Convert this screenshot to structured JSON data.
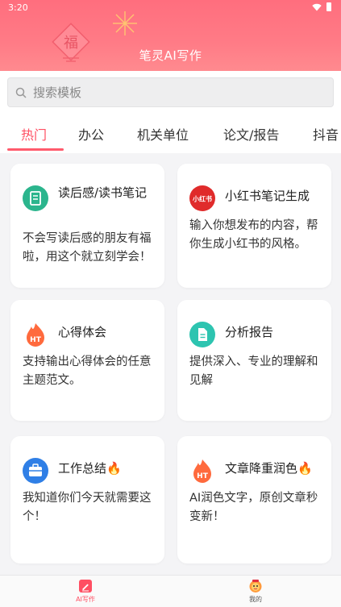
{
  "status_bar": {
    "time": "3:20"
  },
  "app": {
    "title": "笔灵AI写作"
  },
  "search": {
    "placeholder": "搜索模板"
  },
  "tabs": [
    {
      "label": "热门",
      "active": true
    },
    {
      "label": "办公",
      "active": false
    },
    {
      "label": "机关单位",
      "active": false
    },
    {
      "label": "论文/报告",
      "active": false
    },
    {
      "label": "抖音",
      "active": false
    }
  ],
  "cards": [
    {
      "title": "读后感/读书笔记",
      "desc": "不会写读后感的朋友有福啦，用这个就立刻学会！",
      "icon": "notebook-icon",
      "color": "#2bb58d"
    },
    {
      "title": "小红书笔记生成",
      "desc": "输入你想发布的内容，帮你生成小红书的风格。",
      "icon": "xiaohongshu-icon",
      "icon_text": "小红书",
      "color": "#e02b2b"
    },
    {
      "title": "心得体会",
      "desc": "支持输出心得体会的任意主题范文。",
      "icon": "ht-flame-icon",
      "icon_text": "HT",
      "color": "#ff6a3d"
    },
    {
      "title": "分析报告",
      "desc": "提供深入、专业的理解和见解",
      "icon": "document-icon",
      "color": "#2dc4b0"
    },
    {
      "title": "工作总结🔥",
      "desc": "我知道你们今天就需要这个！",
      "icon": "toolbox-icon",
      "color": "#2f7fe6"
    },
    {
      "title": "文章降重润色🔥",
      "desc": "AI润色文字，原创文章秒变新！",
      "icon": "ht-flame-icon",
      "icon_text": "HT",
      "color": "#ff6a3d"
    }
  ],
  "bottom_nav": [
    {
      "label": "AI写作",
      "icon": "pen-icon",
      "active": true
    },
    {
      "label": "我的",
      "icon": "lion-mascot-icon",
      "active": false
    }
  ],
  "colors": {
    "accent": "#ff4f63",
    "header": "#ff7584"
  }
}
